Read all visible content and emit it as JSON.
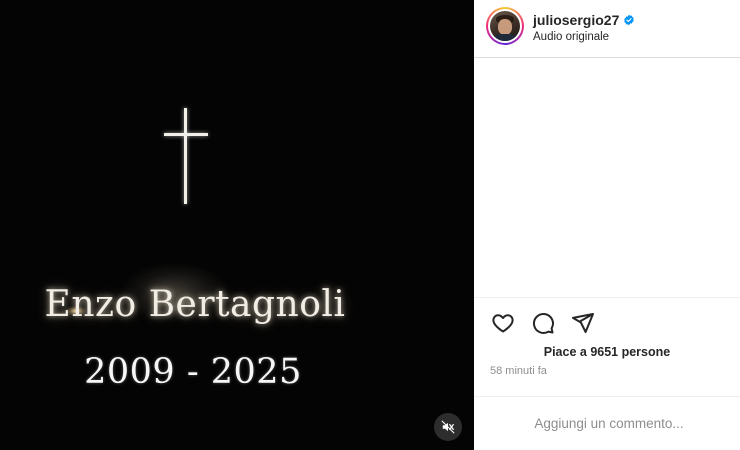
{
  "post": {
    "username": "juliosergio27",
    "audio": "Audio originale",
    "likes_text": "Piace a 9651 persone",
    "time_ago": "58 minuti fa",
    "comment_placeholder": "Aggiungi un commento..."
  },
  "media": {
    "name": "Enzo Bertagnoli",
    "years": "2009 - 2025",
    "muted": true
  },
  "icons": {
    "verified": "verified-badge-icon",
    "like": "heart-icon",
    "comment": "comment-icon",
    "share": "paper-plane-icon",
    "mute": "speaker-muted-icon",
    "cross": "cross-icon"
  },
  "colors": {
    "verified_blue": "#0095f6",
    "media_background": "#040404",
    "text_primary": "#262626",
    "text_secondary": "#8e8e8e"
  }
}
